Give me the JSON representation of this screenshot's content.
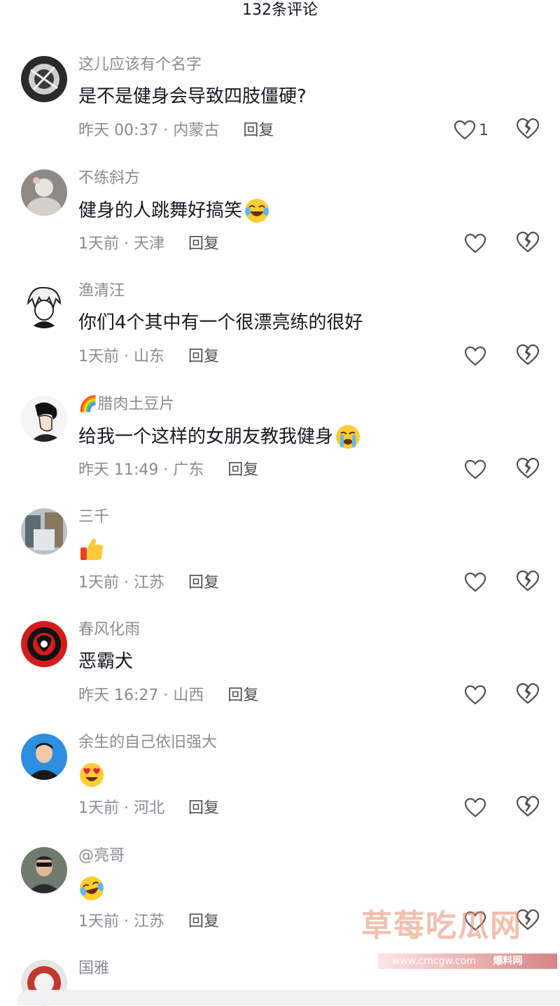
{
  "header": {
    "title": "132条评论"
  },
  "comments": [
    {
      "username": "这儿应该有个名字",
      "text": "是不是健身会导致四肢僵硬?",
      "emoji": "",
      "time": "昨天 00:37 · 内蒙古",
      "reply": "回复",
      "likes": "1"
    },
    {
      "username": "不练斜方",
      "text": "健身的人跳舞好搞笑",
      "emoji": "laugh-cry-emoji",
      "time": "1天前 · 天津",
      "reply": "回复",
      "likes": ""
    },
    {
      "username": "渔清汪",
      "text": "你们4个其中有一个很漂亮练的很好",
      "emoji": "",
      "time": "1天前 · 山东",
      "reply": "回复",
      "likes": ""
    },
    {
      "username": "🌈腊肉土豆片",
      "text": "给我一个这样的女朋友教我健身",
      "emoji": "crying-emoji",
      "time": "昨天 11:49 · 广东",
      "reply": "回复",
      "likes": ""
    },
    {
      "username": "三千",
      "text": "",
      "emoji": "thumbs-up-emoji",
      "time": "1天前 · 江苏",
      "reply": "回复",
      "likes": ""
    },
    {
      "username": "春风化雨",
      "text": "恶霸犬",
      "emoji": "",
      "time": "昨天 16:27 · 山西",
      "reply": "回复",
      "likes": ""
    },
    {
      "username": "余生的自己依旧强大",
      "text": "",
      "emoji": "heart-eyes-emoji",
      "time": "1天前 · 河北",
      "reply": "回复",
      "likes": ""
    },
    {
      "username": "@亮哥",
      "text": "",
      "emoji": "laugh-cry-emoji",
      "time": "1天前 · 江苏",
      "reply": "回复",
      "likes": ""
    },
    {
      "username": "国雅",
      "text": "",
      "emoji": "",
      "time": "",
      "reply": "",
      "likes": ""
    }
  ],
  "watermark": {
    "logo": "草莓吃瓜网",
    "url": "www.cmcgw.com",
    "tag": "爆料网"
  },
  "colors": {
    "text": "#161823",
    "secondary": "#8a8b91",
    "reply": "#505050"
  }
}
